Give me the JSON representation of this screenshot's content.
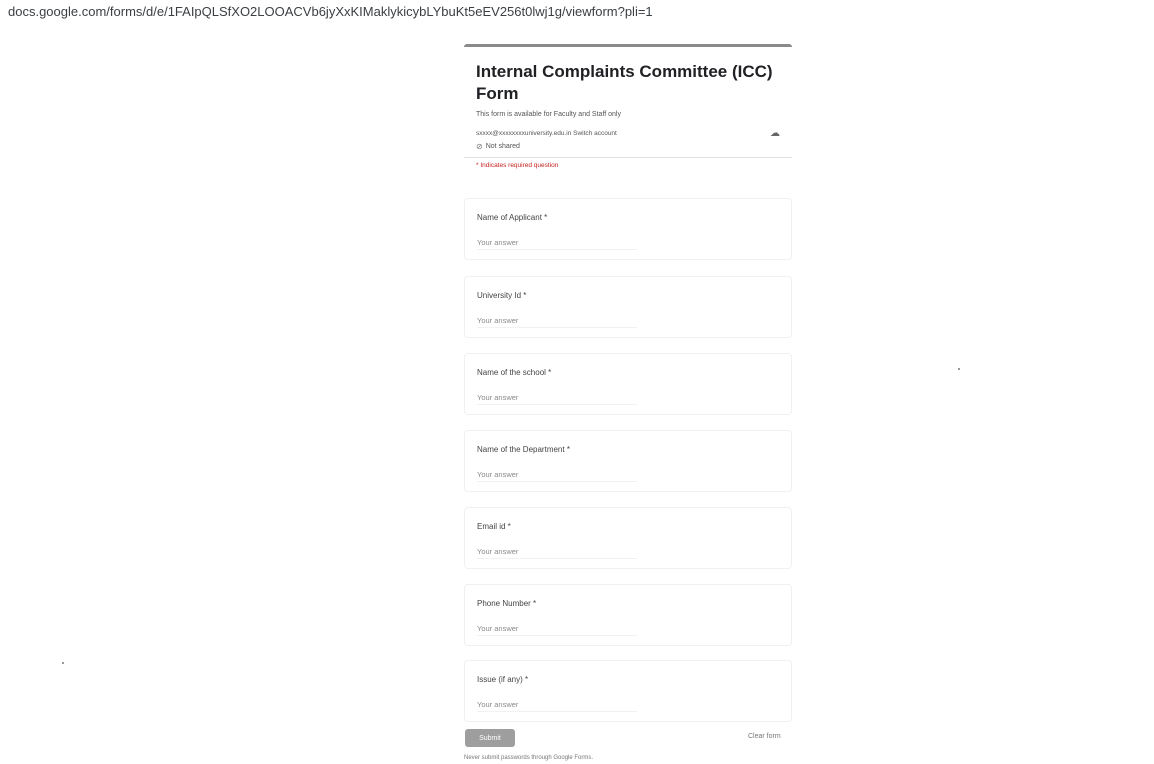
{
  "browser": {
    "url": "docs.google.com/forms/d/e/1FAIpQLSfXO2LOOACVb6jyXxKIMaklykicybLYbuKt5eEV256t0lwj1g/viewform?pli=1"
  },
  "form": {
    "title": "Internal Complaints Committee (ICC) Form",
    "description": "This form is available for Faculty and Staff only",
    "account_email": "sxxxx@xxxxxxxxuniversity.edu.in Switch account",
    "not_shared_label": "Not shared",
    "required_note": "* Indicates required question",
    "questions": [
      {
        "label": "Name of Applicant *",
        "placeholder": "Your answer"
      },
      {
        "label": "University Id *",
        "placeholder": "Your answer"
      },
      {
        "label": "Name of the school *",
        "placeholder": "Your answer"
      },
      {
        "label": "Name of the Department *",
        "placeholder": "Your answer"
      },
      {
        "label": "Email id *",
        "placeholder": "Your answer"
      },
      {
        "label": "Phone Number *",
        "placeholder": "Your answer"
      },
      {
        "label": "Issue (if any) *",
        "placeholder": "Your answer"
      }
    ],
    "submit_label": "Submit",
    "clear_label": "Clear form",
    "footer_note": "Never submit passwords through Google Forms."
  },
  "icons": {
    "cloud": "cloud-saved-icon",
    "not_shared": "not-shared-icon"
  },
  "colors": {
    "accent_bar": "#8a8a8a",
    "submit_button": "#9e9e9e",
    "required": "#c5221f"
  }
}
